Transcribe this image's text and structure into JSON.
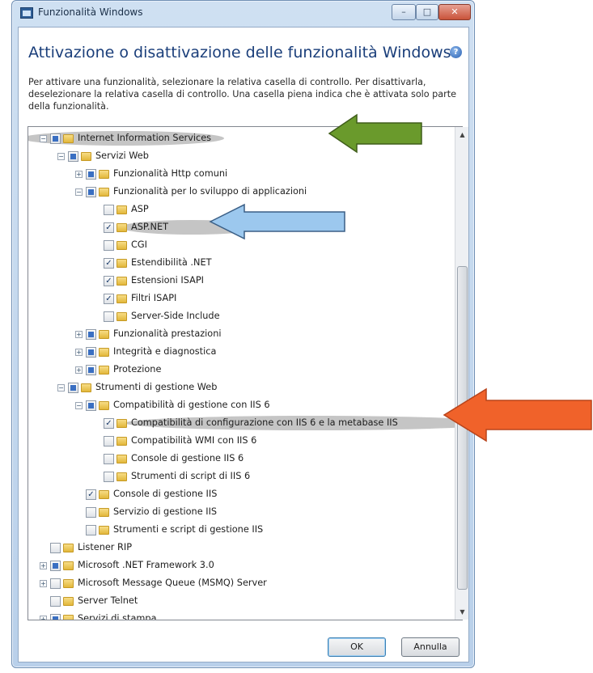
{
  "window": {
    "title": "Funzionalità Windows",
    "minimize_label": "–",
    "maximize_label": "□",
    "close_label": "✕"
  },
  "heading": "Attivazione o disattivazione delle funzionalità Windows",
  "help_label": "?",
  "description": "Per attivare una funzionalità, selezionare la relativa casella di controllo. Per disattivarla, deselezionare la relativa casella di controllo. Una casella piena indica che è attivata solo parte della funzionalità.",
  "tree": [
    {
      "label": "Internet Information Services",
      "level": 0,
      "expander": "minus",
      "state": "partial"
    },
    {
      "label": "Servizi Web",
      "level": 1,
      "expander": "minus",
      "state": "partial"
    },
    {
      "label": "Funzionalità Http comuni",
      "level": 2,
      "expander": "plus",
      "state": "partial"
    },
    {
      "label": "Funzionalità per lo sviluppo di applicazioni",
      "level": 2,
      "expander": "minus",
      "state": "partial"
    },
    {
      "label": "ASP",
      "level": 3,
      "expander": "none",
      "state": "unchecked"
    },
    {
      "label": "ASP.NET",
      "level": 3,
      "expander": "none",
      "state": "checked"
    },
    {
      "label": "CGI",
      "level": 3,
      "expander": "none",
      "state": "unchecked"
    },
    {
      "label": "Estendibilità .NET",
      "level": 3,
      "expander": "none",
      "state": "checked"
    },
    {
      "label": "Estensioni ISAPI",
      "level": 3,
      "expander": "none",
      "state": "checked"
    },
    {
      "label": "Filtri ISAPI",
      "level": 3,
      "expander": "none",
      "state": "checked"
    },
    {
      "label": "Server-Side Include",
      "level": 3,
      "expander": "none",
      "state": "unchecked"
    },
    {
      "label": "Funzionalità prestazioni",
      "level": 2,
      "expander": "plus",
      "state": "partial"
    },
    {
      "label": "Integrità e diagnostica",
      "level": 2,
      "expander": "plus",
      "state": "partial"
    },
    {
      "label": "Protezione",
      "level": 2,
      "expander": "plus",
      "state": "partial"
    },
    {
      "label": "Strumenti di gestione Web",
      "level": 1,
      "expander": "minus",
      "state": "partial"
    },
    {
      "label": "Compatibilità di gestione con IIS 6",
      "level": 2,
      "expander": "minus",
      "state": "partial"
    },
    {
      "label": "Compatibilità di configurazione con IIS 6 e la metabase IIS",
      "level": 3,
      "expander": "none",
      "state": "checked"
    },
    {
      "label": "Compatibilità WMI con IIS 6",
      "level": 3,
      "expander": "none",
      "state": "unchecked"
    },
    {
      "label": "Console di gestione IIS 6",
      "level": 3,
      "expander": "none",
      "state": "unchecked"
    },
    {
      "label": "Strumenti di script di IIS 6",
      "level": 3,
      "expander": "none",
      "state": "unchecked"
    },
    {
      "label": "Console di gestione IIS",
      "level": 2,
      "expander": "none",
      "state": "checked"
    },
    {
      "label": "Servizio di gestione IIS",
      "level": 2,
      "expander": "none",
      "state": "unchecked"
    },
    {
      "label": "Strumenti e script di gestione IIS",
      "level": 2,
      "expander": "none",
      "state": "unchecked"
    },
    {
      "label": "Listener RIP",
      "level": 0,
      "expander": "none",
      "state": "unchecked"
    },
    {
      "label": "Microsoft .NET Framework 3.0",
      "level": 0,
      "expander": "plus",
      "state": "partial"
    },
    {
      "label": "Microsoft Message Queue (MSMQ) Server",
      "level": 0,
      "expander": "plus",
      "state": "unchecked"
    },
    {
      "label": "Server Telnet",
      "level": 0,
      "expander": "none",
      "state": "unchecked"
    },
    {
      "label": "Servizi di stampa",
      "level": 0,
      "expander": "plus",
      "state": "partial"
    }
  ],
  "buttons": {
    "ok": "OK",
    "cancel": "Annulla"
  },
  "annotation_colors": {
    "green": "#6a9a2c",
    "blue": "#9cc8ee",
    "orange": "#f0622a"
  }
}
